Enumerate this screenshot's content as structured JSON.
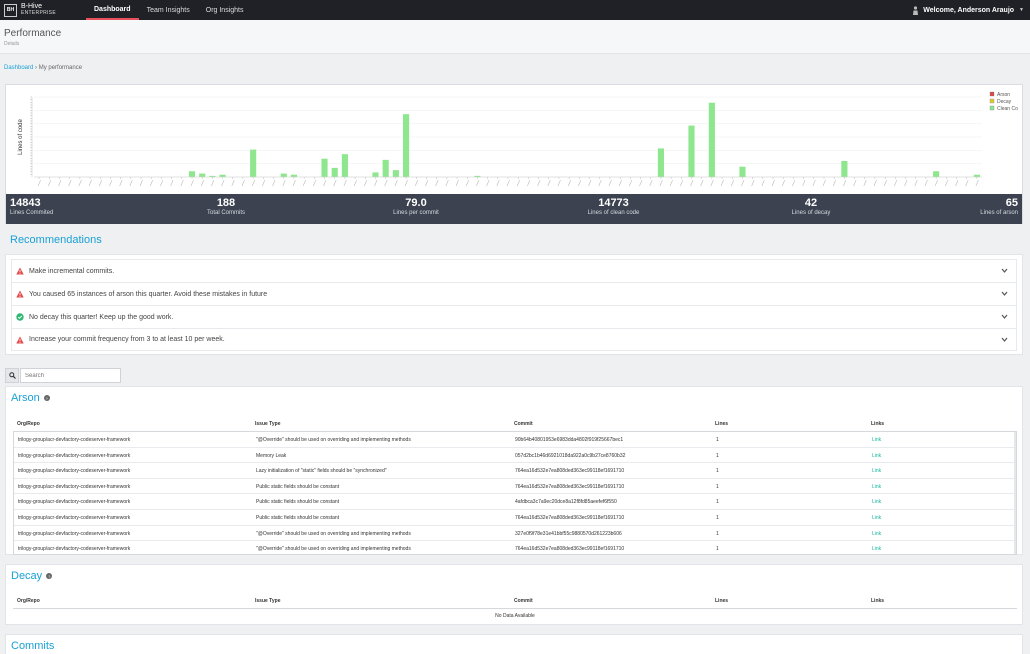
{
  "nav": {
    "logo_mark": "BH",
    "brand_line1": "B-Hive",
    "brand_line2": "ENTERPRISE",
    "tabs": [
      {
        "label": "Dashboard",
        "active": true
      },
      {
        "label": "Team Insights",
        "active": false
      },
      {
        "label": "Org Insights",
        "active": false
      }
    ],
    "welcome": "Welcome, Anderson Araujo"
  },
  "page": {
    "title": "Performance",
    "subtitle": "Details"
  },
  "breadcrumb": {
    "root": "Dashboard",
    "separator": "›",
    "current": "My performance"
  },
  "chart_data": {
    "type": "bar",
    "ylabel": "Lines of code",
    "xlabel": "",
    "legend_position": "top-right",
    "series": [
      {
        "name": "Arson",
        "color": "#d94b4b"
      },
      {
        "name": "Decay",
        "color": "#e6c53d"
      },
      {
        "name": "Clean Code",
        "color": "#8ee68e"
      }
    ],
    "bar_count": 93,
    "clean_code_values": [
      0,
      0,
      0,
      0,
      0,
      0,
      0,
      0,
      0,
      0,
      0,
      0,
      0,
      0,
      0,
      5,
      3,
      1,
      2,
      0,
      0,
      24,
      0,
      0,
      3,
      2,
      0,
      0,
      16,
      8,
      20,
      0,
      0,
      4,
      15,
      6,
      55,
      0,
      0,
      0,
      0,
      0,
      0,
      1,
      0,
      0,
      0,
      0,
      0,
      0,
      0,
      0,
      0,
      0,
      0,
      0,
      0,
      0,
      0,
      0,
      0,
      25,
      0,
      0,
      45,
      0,
      65,
      0,
      0,
      9,
      0,
      0,
      0,
      0,
      0,
      0,
      0,
      0,
      0,
      14,
      0,
      0,
      0,
      0,
      0,
      0,
      0,
      0,
      5,
      0,
      0,
      0,
      2
    ],
    "ylim": [
      0,
      70
    ]
  },
  "stats": [
    {
      "value": "14843",
      "label": "Lines Commited"
    },
    {
      "value": "188",
      "label": "Total Commits"
    },
    {
      "value": "79.0",
      "label": "Lines per commit"
    },
    {
      "value": "14773",
      "label": "Lines of clean code"
    },
    {
      "value": "42",
      "label": "Lines of decay"
    },
    {
      "value": "65",
      "label": "Lines of arson"
    }
  ],
  "recommendations": {
    "title": "Recommendations",
    "items": [
      {
        "text": "Make incremental commits.",
        "status": "warning"
      },
      {
        "text": "You caused 65 instances of arson this quarter. Avoid these mistakes in future",
        "status": "warning"
      },
      {
        "text": "No decay this quarter! Keep up the good work.",
        "status": "success"
      },
      {
        "text": "Increase your commit frequency from 3 to at least 10 per week.",
        "status": "warning"
      }
    ]
  },
  "search": {
    "placeholder": "Search"
  },
  "arson": {
    "title": "Arson",
    "columns": [
      "Org/Repo",
      "Issue Type",
      "Commit",
      "Lines",
      "Links"
    ],
    "rows": [
      [
        "trilogy-group/acr-devfactory-codeserver-framework",
        "\"@Override\" should be used on overriding and implementing methods",
        "90b64b40801953e6983dda4802f919f25667bec1",
        "1",
        "Link"
      ],
      [
        "trilogy-group/acr-devfactory-codeserver-framework",
        "Memory Leak",
        "057d2bc1b46d6921018da922a0c9b27ce8760b32",
        "1",
        "Link"
      ],
      [
        "trilogy-group/acr-devfactory-codeserver-framework",
        "Lazy initialization of \"static\" fields should be \"synchronized\"",
        "764ea16d532e7ea808ded363ec99118ef1691710",
        "1",
        "Link"
      ],
      [
        "trilogy-group/acr-devfactory-codeserver-framework",
        "Public static fields should be constant",
        "764ea16d532e7ea808ded363ec99118ef1691710",
        "1",
        "Link"
      ],
      [
        "trilogy-group/acr-devfactory-codeserver-framework",
        "Public static fields should be constant",
        "4afdbca3c7a9ec20dce8a12f8fd85aeefef6f550",
        "1",
        "Link"
      ],
      [
        "trilogy-group/acr-devfactory-codeserver-framework",
        "Public static fields should be constant",
        "764ea16d532e7ea808ded363ec99118ef1691710",
        "1",
        "Link"
      ],
      [
        "trilogy-group/acr-devfactory-codeserver-framework",
        "\"@Override\" should be used on overriding and implementing methods",
        "327e0f9f78e31e41bbf55c9880570d261223b606",
        "1",
        "Link"
      ],
      [
        "trilogy-group/acr-devfactory-codeserver-framework",
        "\"@Override\" should be used on overriding and implementing methods",
        "764ea16d532e7ea808ded363ec99118ef1691710",
        "1",
        "Link"
      ]
    ]
  },
  "decay": {
    "title": "Decay",
    "columns": [
      "Org/Repo",
      "Issue Type",
      "Commit",
      "Lines",
      "Links"
    ],
    "empty_text": "No Data Available"
  },
  "commits": {
    "title": "Commits"
  },
  "help_glyph": "?"
}
